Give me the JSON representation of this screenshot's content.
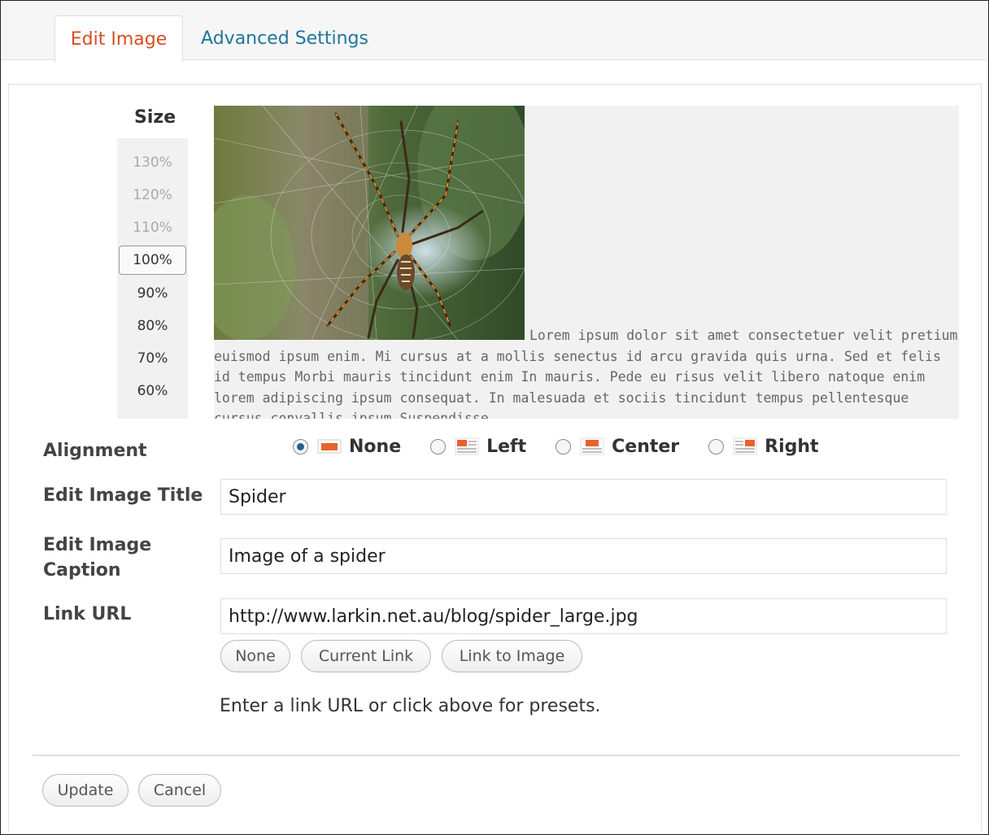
{
  "tabs": {
    "edit": "Edit Image",
    "advanced": "Advanced Settings"
  },
  "size": {
    "title": "Size",
    "options": [
      "130%",
      "120%",
      "110%",
      "100%",
      "90%",
      "80%",
      "70%",
      "60%"
    ],
    "selected": "100%"
  },
  "preview": {
    "image_alt": "Spider on web photo",
    "text": "Lorem ipsum dolor sit amet consectetuer velit pretium euismod ipsum enim. Mi cursus at a mollis senectus id arcu gravida quis urna. Sed et felis id tempus Morbi mauris tincidunt enim In mauris. Pede eu risus velit libero natoque enim lorem adipiscing ipsum consequat. In malesuada et sociis tincidunt tempus pellentesque cursus convallis ipsum Suspendisse"
  },
  "alignment": {
    "label": "Alignment",
    "options": [
      "None",
      "Left",
      "Center",
      "Right"
    ],
    "selected": "None"
  },
  "title_field": {
    "label": "Edit Image Title",
    "value": "Spider"
  },
  "caption_field": {
    "label_line1": "Edit Image",
    "label_line2": "Caption",
    "value": "Image of a spider"
  },
  "link_field": {
    "label": "Link URL",
    "value": "http://www.larkin.net.au/blog/spider_large.jpg",
    "presets": [
      "None",
      "Current Link",
      "Link to Image"
    ],
    "help": "Enter a link URL or click above for presets."
  },
  "actions": {
    "update": "Update",
    "cancel": "Cancel"
  },
  "colors": {
    "active_tab": "#d54e21",
    "link_tab": "#21759b",
    "radio_on": "#2b5e8a",
    "icon_accent": "#e8632a"
  }
}
